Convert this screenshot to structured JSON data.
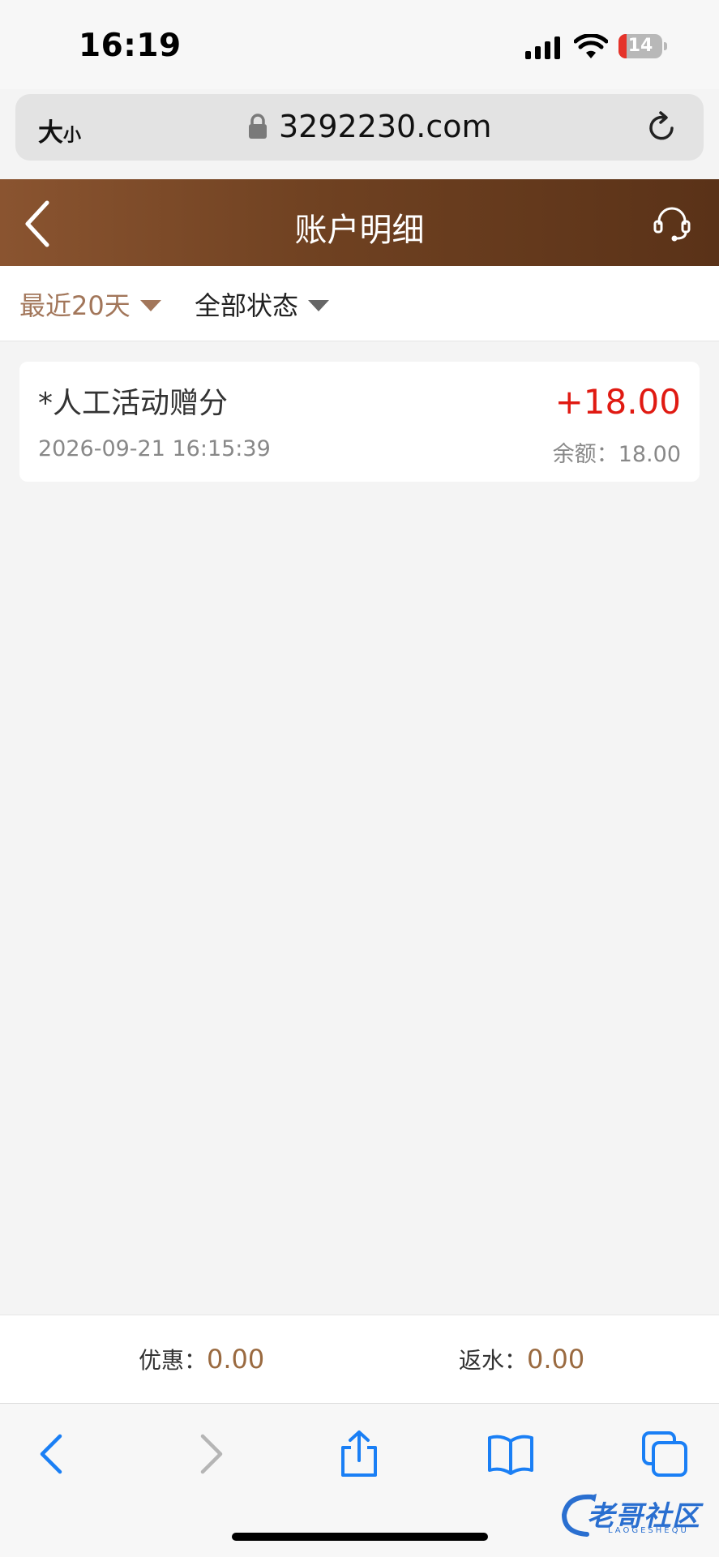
{
  "status_bar": {
    "time": "16:19",
    "battery": "14"
  },
  "browser": {
    "text_size_big": "大",
    "text_size_small": "小",
    "url": "3292230.com"
  },
  "header": {
    "title": "账户明细"
  },
  "filters": {
    "date_range": "最近20天",
    "status": "全部状态"
  },
  "transactions": [
    {
      "title": "*人工活动赠分",
      "time": "2026-09-21 16:15:39",
      "amount": "+18.00",
      "balance": "余额：18.00"
    }
  ],
  "summary": {
    "discount_label": "优惠：",
    "discount_value": "0.00",
    "rebate_label": "返水：",
    "rebate_value": "0.00"
  },
  "watermark": {
    "text": "老哥社区",
    "sub": "LAOGESHEQU"
  },
  "colors": {
    "header_start": "#8a5430",
    "header_end": "#5a3218",
    "amount": "#e01a12",
    "accent": "#a2765a",
    "ios_blue": "#1a7ff5"
  },
  "icons": [
    "lock-icon",
    "reload-icon",
    "back-icon",
    "headset-icon",
    "chevron-left-icon",
    "chevron-right-icon",
    "share-icon",
    "book-icon",
    "tabs-icon"
  ]
}
